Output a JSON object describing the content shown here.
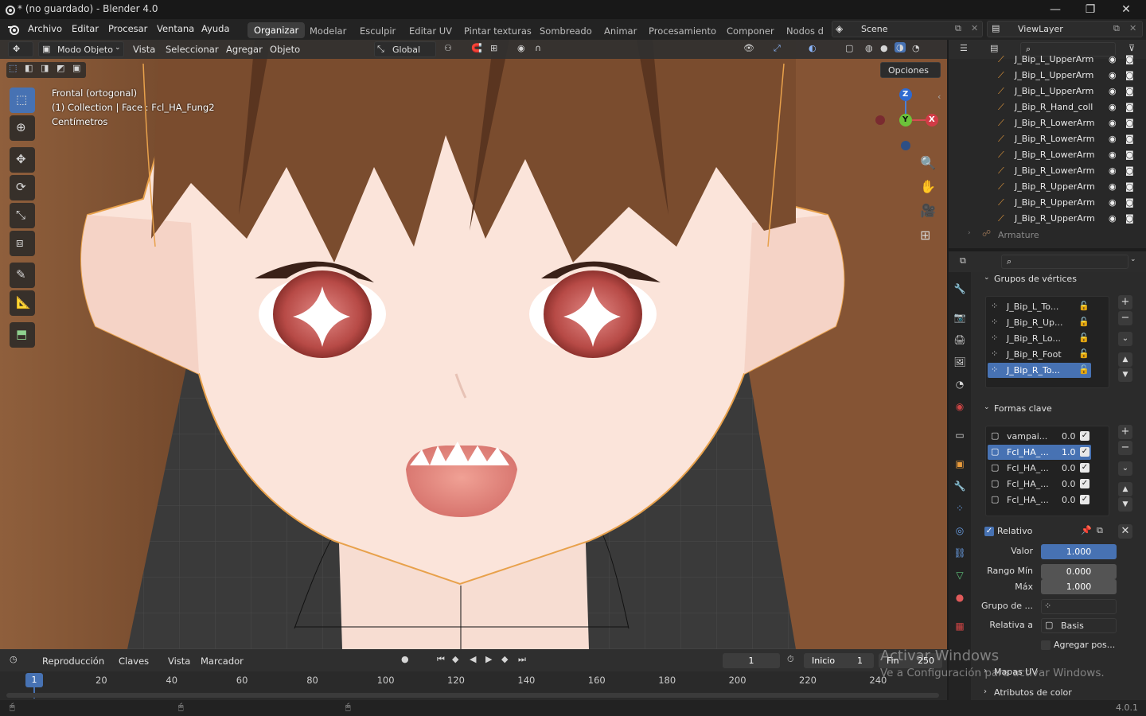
{
  "window": {
    "title": "* (no guardado) - Blender 4.0",
    "controls": [
      "—",
      "❐",
      "✕"
    ]
  },
  "menus": [
    "Archivo",
    "Editar",
    "Procesar",
    "Ventana",
    "Ayuda"
  ],
  "workspaces": {
    "items": [
      "Organizar",
      "Modelar",
      "Esculpir",
      "Editar UV",
      "Pintar texturas",
      "Sombreado",
      "Animar",
      "Procesamiento",
      "Componer",
      "Nodos d"
    ],
    "active": "Organizar"
  },
  "scene": {
    "label": "Scene"
  },
  "viewlayer": {
    "label": "ViewLayer"
  },
  "viewport": {
    "mode": "Modo Objeto",
    "menus": [
      "Vista",
      "Seleccionar",
      "Agregar",
      "Objeto"
    ],
    "transform": "Global",
    "options": "Opciones",
    "info": {
      "view": "Frontal (ortogonal)",
      "object": "(1) Collection | Face : Fcl_HA_Fung2",
      "units": "Centímetros"
    },
    "gizmo": {
      "z": "Z",
      "y": "Y",
      "x": "X"
    }
  },
  "outliner": {
    "rows": [
      "J_Bip_L_UpperArm",
      "J_Bip_L_UpperArm",
      "J_Bip_L_UpperArm",
      "J_Bip_R_Hand_coll",
      "J_Bip_R_LowerArm",
      "J_Bip_R_LowerArm",
      "J_Bip_R_LowerArm",
      "J_Bip_R_LowerArm",
      "J_Bip_R_UpperArm",
      "J_Bip_R_UpperArm",
      "J_Bip_R_UpperArm"
    ],
    "armature": "Armature"
  },
  "properties": {
    "vertex_groups": {
      "title": "Grupos de vértices",
      "items": [
        "J_Bip_L_To...",
        "J_Bip_R_Up...",
        "J_Bip_R_Lo...",
        "J_Bip_R_Foot",
        "J_Bip_R_To..."
      ],
      "selected": 4
    },
    "shape_keys": {
      "title": "Formas clave",
      "items": [
        {
          "name": "vampai...",
          "value": "0.0"
        },
        {
          "name": "Fcl_HA_...",
          "value": "1.0"
        },
        {
          "name": "Fcl_HA_...",
          "value": "0.0"
        },
        {
          "name": "Fcl_HA_...",
          "value": "0.0"
        },
        {
          "name": "Fcl_HA_...",
          "value": "0.0"
        }
      ],
      "selected": 1
    },
    "relative": "Relativo",
    "valor_label": "Valor",
    "valor": "1.000",
    "rango_min_label": "Rango Mín",
    "rango_min": "0.000",
    "max_label": "Máx",
    "max": "1.000",
    "grupo_label": "Grupo de ...",
    "relativa_label": "Relativa a",
    "relativa": "Basis",
    "agregar": "Agregar pos...",
    "uv_maps": "Mapas UV",
    "color_attr": "Atributos de color"
  },
  "timeline": {
    "menus": [
      "Reproducción",
      "Claves",
      "Vista",
      "Marcador"
    ],
    "current_frame": "1",
    "start_label": "Inicio",
    "start": "1",
    "end_label": "Fin",
    "end": "250",
    "ticks": [
      "20",
      "40",
      "60",
      "80",
      "100",
      "120",
      "140",
      "160",
      "180",
      "200",
      "220",
      "240"
    ],
    "playhead": "1"
  },
  "watermark": {
    "line1": "Activar Windows",
    "line2": "Ve a Configuración para activar Windows."
  },
  "status": {
    "version": "4.0.1"
  }
}
